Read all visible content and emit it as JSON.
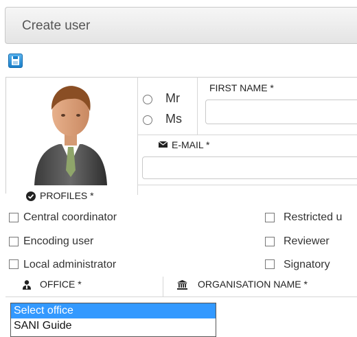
{
  "header": {
    "title": "Create user"
  },
  "toolbar": {
    "save_icon": "save-icon"
  },
  "salutation": {
    "options": [
      "Mr",
      "Ms"
    ]
  },
  "first_name": {
    "label": "FIRST NAME *",
    "value": ""
  },
  "email": {
    "label": "E-MAIL *",
    "value": "",
    "icon": "envelope-icon"
  },
  "profiles": {
    "label": "PROFILES *",
    "icon": "check-circle-icon",
    "left": [
      "Central coordinator",
      "Encoding user",
      "Local administrator"
    ],
    "right": [
      "Restricted u",
      "Reviewer",
      "Signatory"
    ]
  },
  "office": {
    "label": "OFFICE *",
    "icon": "user-tie-icon"
  },
  "organisation": {
    "label": "ORGANISATION NAME *",
    "icon": "bank-icon"
  },
  "office_dropdown": {
    "options": [
      "Select office",
      "SANI Guide"
    ],
    "selected": "Select office"
  },
  "colors": {
    "accent": "#3399ff",
    "save_icon": "#1a7fc9"
  }
}
